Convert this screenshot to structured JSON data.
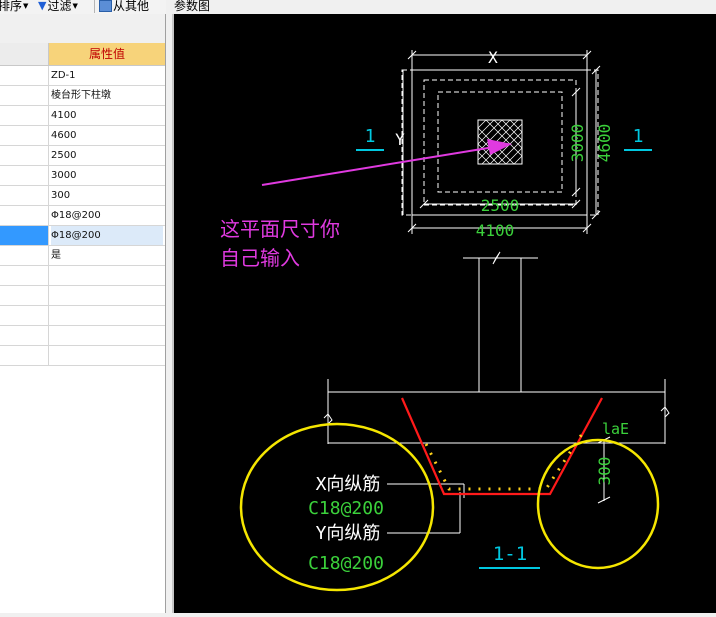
{
  "toolbar": {
    "sort_label": "排序",
    "filter_label": "过滤",
    "from_other_label": "从其他"
  },
  "props_grid": {
    "column_header": "属性值",
    "rows": [
      {
        "value": "ZD-1"
      },
      {
        "value": "棱台形下柱墩"
      },
      {
        "value": "4100"
      },
      {
        "value": "4600"
      },
      {
        "value": "2500"
      },
      {
        "value": "3000"
      },
      {
        "value": "300"
      },
      {
        "value": "Φ18@200"
      },
      {
        "value": "Φ18@200"
      },
      {
        "value": "是"
      },
      {
        "value": ""
      },
      {
        "value": ""
      },
      {
        "value": ""
      },
      {
        "value": ""
      },
      {
        "value": ""
      }
    ]
  },
  "panel": {
    "title": "参数图"
  },
  "drawing": {
    "dim_x": "X",
    "dim_y": "Y",
    "dim_2500": "2500",
    "dim_4100": "4100",
    "dim_3000": "3000",
    "dim_4600": "4600",
    "section_mark_left": "1",
    "section_mark_right": "1",
    "note_line1": "这平面尺寸你",
    "note_line2": "自己输入",
    "rebar_x_label": "X向纵筋",
    "rebar_x_value": "C18@200",
    "rebar_y_label": "Y向纵筋",
    "rebar_y_value": "C18@200",
    "lae_label": "laE",
    "dim_300": "300",
    "section_title": "1-1"
  },
  "colors": {
    "canvas_bg": "#000000",
    "cad_white": "#ffffff",
    "cad_green": "#3bd13b",
    "cad_cyan": "#00c8e0",
    "magenta": "#e03ae0",
    "rebar_red": "#ff1a1a",
    "highlight_yellow": "#f5e600",
    "header_highlight": "#f7d37a"
  }
}
